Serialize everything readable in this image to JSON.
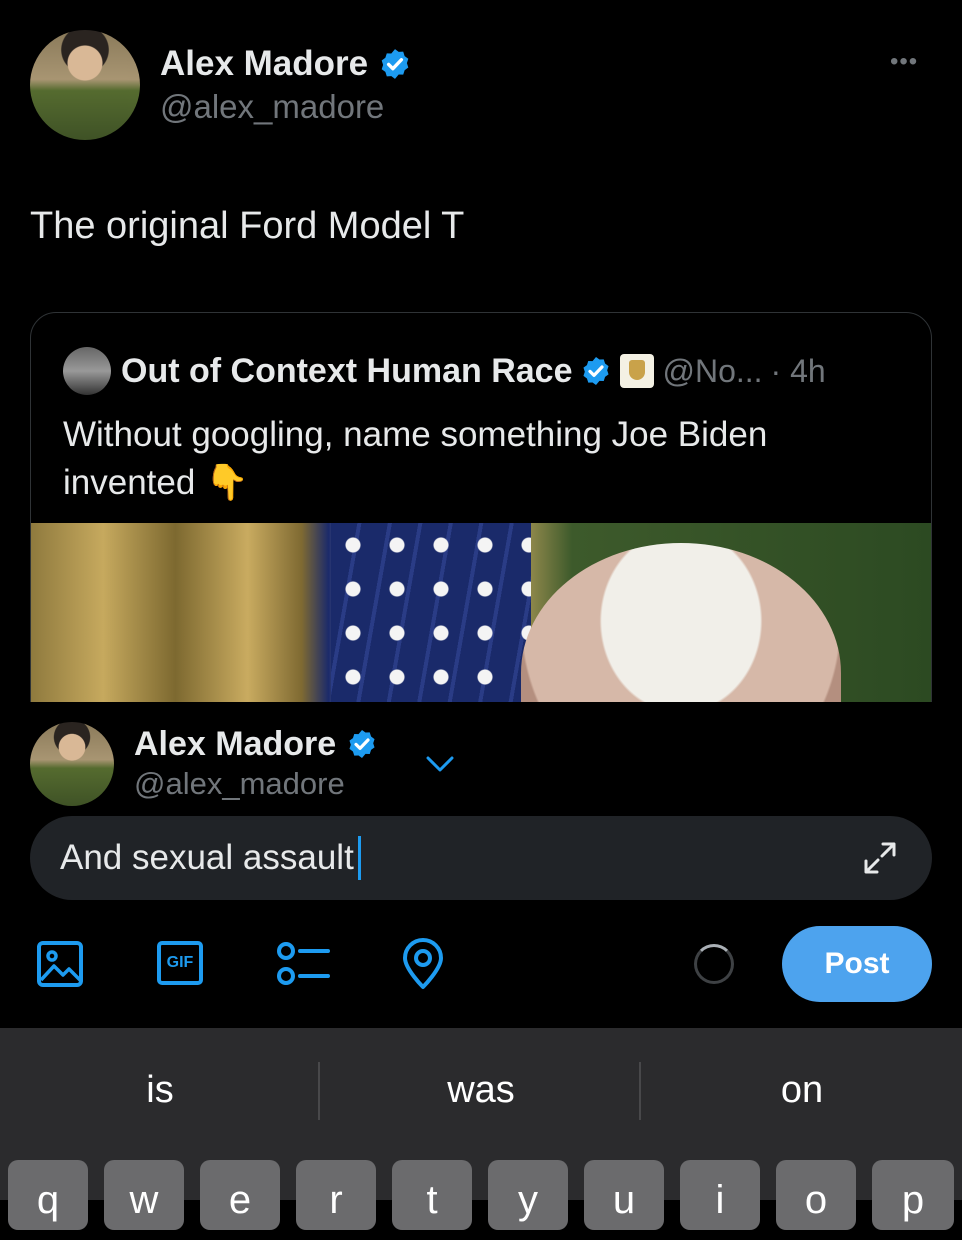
{
  "tweet": {
    "author_name": "Alex Madore",
    "author_handle": "@alex_madore",
    "text": "The original Ford Model T",
    "more_label": "•••"
  },
  "quote": {
    "author_name": "Out of Context Human Race",
    "author_handle": "@No...",
    "time": "· 4h",
    "text": "Without googling, name something Joe Biden invented 👇"
  },
  "composer": {
    "author_name": "Alex Madore",
    "author_handle": "@alex_madore",
    "input_value": "And sexual assault",
    "post_label": "Post",
    "gif_label": "GIF"
  },
  "keyboard": {
    "suggestions": [
      "is",
      "was",
      "on"
    ],
    "keys": [
      "q",
      "w",
      "e",
      "r",
      "t",
      "y",
      "u",
      "i",
      "o",
      "p"
    ]
  },
  "colors": {
    "accent": "#1d9bf0",
    "post_button": "#4da3ee",
    "background": "#000000",
    "secondary_text": "#71767b"
  }
}
